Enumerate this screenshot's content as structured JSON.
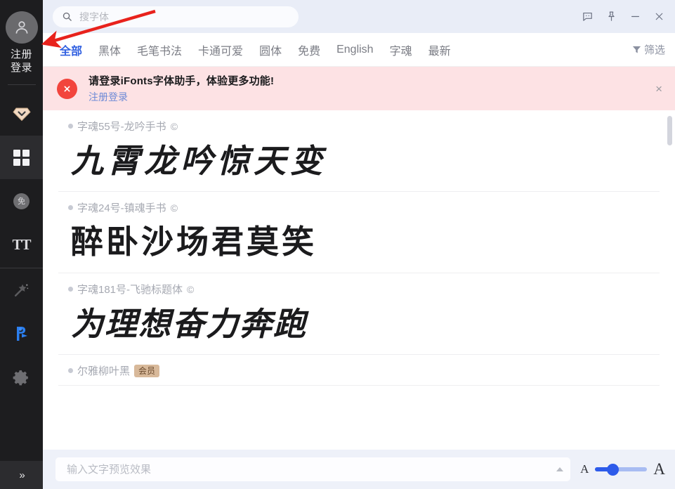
{
  "window": {
    "controls": [
      {
        "name": "feedback-icon",
        "label": "feedback-icon"
      },
      {
        "name": "pin-icon",
        "label": "pin-icon"
      },
      {
        "name": "minimize-icon",
        "label": "minimize-icon"
      },
      {
        "name": "close-icon",
        "label": "close-icon"
      }
    ]
  },
  "search": {
    "placeholder": "搜字体",
    "value": "",
    "icon": "search-icon"
  },
  "sidebar": {
    "avatar": {
      "icon": "user-avatar-icon",
      "line1": "注册",
      "line2": "登录"
    },
    "items": [
      {
        "name": "vip-diamond",
        "icon": "diamond-icon",
        "active": false
      },
      {
        "name": "font-library",
        "icon": "grid-icon",
        "active": true
      },
      {
        "name": "free-fonts",
        "icon": "free-badge-icon",
        "badge": "免",
        "active": false
      },
      {
        "name": "my-fonts",
        "icon": "tt-icon",
        "label": "TT",
        "active": false
      },
      {
        "name": "effects",
        "icon": "magic-wand-icon",
        "active": false
      },
      {
        "name": "design-tool",
        "icon": "ps-plugin-icon",
        "label": "F",
        "active": false
      },
      {
        "name": "settings",
        "icon": "gear-icon",
        "active": false
      }
    ],
    "expand": "»"
  },
  "tabs": [
    {
      "label": "全部",
      "active": true
    },
    {
      "label": "黑体",
      "active": false
    },
    {
      "label": "毛笔书法",
      "active": false
    },
    {
      "label": "卡通可爱",
      "active": false
    },
    {
      "label": "圆体",
      "active": false
    },
    {
      "label": "免费",
      "active": false
    },
    {
      "label": "English",
      "active": false
    },
    {
      "label": "字魂",
      "active": false
    },
    {
      "label": "最新",
      "active": false
    }
  ],
  "filter": {
    "label": "筛选",
    "icon": "funnel-icon"
  },
  "banner": {
    "icon": "error-circle-icon",
    "title": "请登录iFonts字体助手，体验更多功能!",
    "link": "注册登录",
    "close": "×"
  },
  "font_list": [
    {
      "name": "字魂55号-龙吟手书",
      "copyright": "©",
      "badge": "",
      "sample": "九霄龙吟惊天变",
      "style": "sample-brush"
    },
    {
      "name": "字魂24号-镇魂手书",
      "copyright": "©",
      "badge": "",
      "sample": "醉卧沙场君莫笑",
      "style": "sample-brush2"
    },
    {
      "name": "字魂181号-飞驰标题体",
      "copyright": "©",
      "badge": "",
      "sample": "为理想奋力奔跑",
      "style": "sample-bold"
    },
    {
      "name": "尔雅柳叶黑",
      "copyright": "",
      "badge": "会员",
      "sample": "",
      "style": "sample-bold"
    }
  ],
  "bottom": {
    "preview_placeholder": "输入文字预览效果",
    "preview_value": "",
    "collapse_icon": "caret-up-icon",
    "size_small_label": "A",
    "size_large_label": "A",
    "slider_percent": 30
  },
  "colors": {
    "accent": "#2f5fe0",
    "titlebar_bg": "#e9edf7",
    "banner_bg": "#fde2e4",
    "banner_icon": "#f2453d",
    "sidebar_bg": "#1d1d1f",
    "annotation_arrow": "#e8221c"
  }
}
